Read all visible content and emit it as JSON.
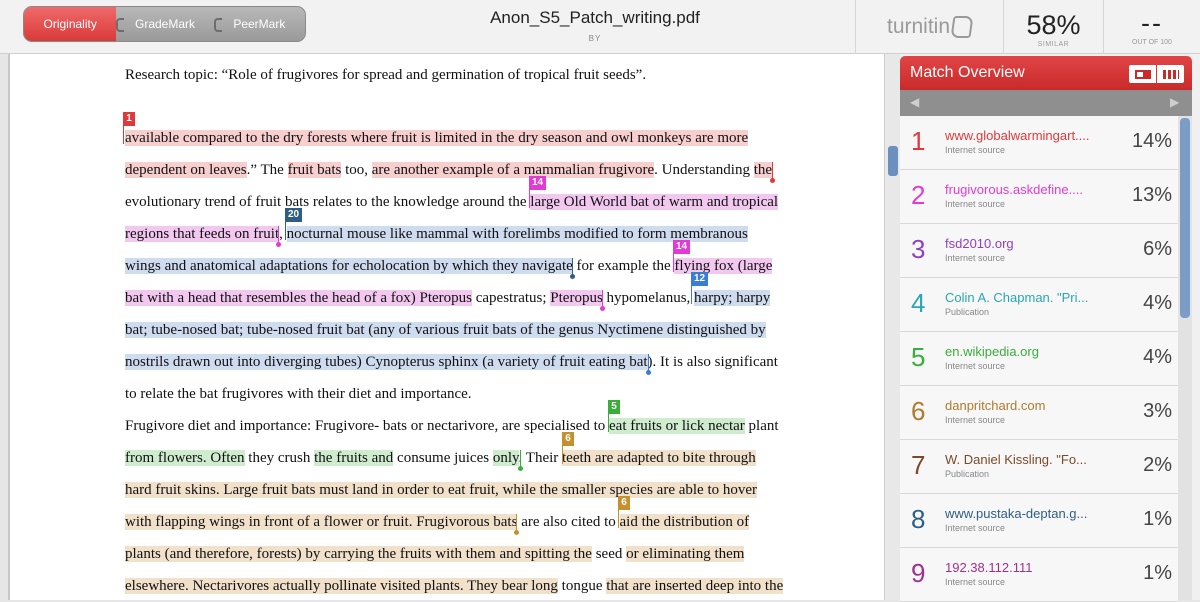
{
  "modes": [
    "Originality",
    "GradeMark",
    "PeerMark"
  ],
  "document": {
    "title": "Anon_S5_Patch_writing.pdf",
    "by": "BY"
  },
  "brand": "turnitin",
  "similarity": {
    "value": "58%",
    "label": "SIMILAR"
  },
  "grade": {
    "value": "--",
    "label": "OUT OF 100"
  },
  "panel": {
    "title": "Match Overview"
  },
  "colors": {
    "red": "#e0393b",
    "pink": "#e23ad6",
    "purple": "#8f3fbf",
    "teal": "#2aa7b5",
    "green": "#3aae3a",
    "brown": "#b07b2e",
    "darkbrown": "#7a4a2a",
    "navy": "#2e5e86",
    "magenta": "#a0308f"
  },
  "matches": [
    {
      "num": "1",
      "source": "www.globalwarmingart....",
      "type": "Internet source",
      "pct": "14%",
      "color": "#e0393b"
    },
    {
      "num": "2",
      "source": "frugivorous.askdefine....",
      "type": "Internet source",
      "pct": "13%",
      "color": "#e23ad6"
    },
    {
      "num": "3",
      "source": "fsd2010.org",
      "type": "Internet source",
      "pct": "6%",
      "color": "#8f3fbf"
    },
    {
      "num": "4",
      "source": "Colin A. Chapman. \"Pri...",
      "type": "Publication",
      "pct": "4%",
      "color": "#2aa7b5"
    },
    {
      "num": "5",
      "source": "en.wikipedia.org",
      "type": "Internet source",
      "pct": "4%",
      "color": "#3aae3a"
    },
    {
      "num": "6",
      "source": "danpritchard.com",
      "type": "Internet source",
      "pct": "3%",
      "color": "#b07b2e"
    },
    {
      "num": "7",
      "source": "W. Daniel Kissling. \"Fo...",
      "type": "Publication",
      "pct": "2%",
      "color": "#7a4a2a"
    },
    {
      "num": "8",
      "source": "www.pustaka-deptan.g...",
      "type": "Internet source",
      "pct": "1%",
      "color": "#2e5e86"
    },
    {
      "num": "9",
      "source": "192.38.112.111",
      "type": "Internet source",
      "pct": "1%",
      "color": "#a0308f"
    }
  ],
  "lines": [
    {
      "segments": [
        {
          "t": "Research topic: “Role of frugivores for spread and germination of tropical fruit seeds”.",
          "h": ""
        }
      ]
    },
    {
      "segments": [
        {
          "t": "available compared to the dry forests where fruit is limited in the dry season and owl monkeys are more",
          "h": "red"
        }
      ]
    },
    {
      "segments": [
        {
          "t": "dependent on leaves",
          "h": "red"
        },
        {
          "t": ".” The ",
          "h": ""
        },
        {
          "t": "fruit bats",
          "h": "red"
        },
        {
          "t": " too, ",
          "h": ""
        },
        {
          "t": "are another example of a mammalian frugivore",
          "h": "red"
        },
        {
          "t": ". Understanding ",
          "h": ""
        },
        {
          "t": "the",
          "h": "red"
        }
      ]
    },
    {
      "segments": [
        {
          "t": "evolutionary trend of fruit bats relates to the knowledge around the ",
          "h": ""
        },
        {
          "t": "large Old World bat of warm and tropical",
          "h": "pink"
        }
      ]
    },
    {
      "segments": [
        {
          "t": "regions that feeds on fruit",
          "h": "pink"
        },
        {
          "t": ", ",
          "h": ""
        },
        {
          "t": "nocturnal mouse like mammal with forelimbs modified to form membranous",
          "h": "blue"
        }
      ]
    },
    {
      "segments": [
        {
          "t": "wings and anatomical adaptations for echolocation by which they navigate",
          "h": "blue"
        },
        {
          "t": " for example the ",
          "h": ""
        },
        {
          "t": "flying fox (large",
          "h": "pink"
        }
      ]
    },
    {
      "segments": [
        {
          "t": "bat with a head that resembles the head of a fox) Pteropus",
          "h": "pink"
        },
        {
          "t": " capestratus; ",
          "h": ""
        },
        {
          "t": "Pteropus",
          "h": "pink"
        },
        {
          "t": " hypomelanus, ",
          "h": ""
        },
        {
          "t": "harpy; harpy",
          "h": "blue"
        }
      ]
    },
    {
      "segments": [
        {
          "t": "bat; tube-nosed bat; tube-nosed fruit bat (any of various fruit bats of the genus Nyctimene distinguished by",
          "h": "blue"
        }
      ]
    },
    {
      "segments": [
        {
          "t": "nostrils drawn out into diverging tubes) Cynopterus sphinx (a variety of fruit eating bat",
          "h": "blue"
        },
        {
          "t": "). It is also significant",
          "h": ""
        }
      ]
    },
    {
      "segments": [
        {
          "t": "to relate the bat frugivores with their diet and importance.",
          "h": ""
        }
      ]
    },
    {
      "segments": [
        {
          "t": "Frugivore diet and importance: Frugivore- bats or nectarivore, are specialised to ",
          "h": ""
        },
        {
          "t": "eat fruits or lick nectar",
          "h": "green"
        },
        {
          "t": " plant",
          "h": ""
        }
      ]
    },
    {
      "segments": [
        {
          "t": "from flowers. Often",
          "h": "green"
        },
        {
          "t": " they crush ",
          "h": ""
        },
        {
          "t": "the fruits and",
          "h": "green"
        },
        {
          "t": " consume juices ",
          "h": ""
        },
        {
          "t": "only",
          "h": "green"
        },
        {
          "t": ". Their ",
          "h": ""
        },
        {
          "t": "teeth are adapted to bite through",
          "h": "tan"
        }
      ]
    },
    {
      "segments": [
        {
          "t": "hard fruit skins. Large fruit bats must land in order to eat fruit, while the smaller species are able to hover",
          "h": "tan"
        }
      ]
    },
    {
      "segments": [
        {
          "t": "with flapping wings in front of a flower or fruit. Frugivorous bats",
          "h": "tan"
        },
        {
          "t": " are also cited to ",
          "h": ""
        },
        {
          "t": "aid the distribution of",
          "h": "tan"
        }
      ]
    },
    {
      "segments": [
        {
          "t": "plants (and therefore, forests) by carrying the fruits with them and spitting the",
          "h": "tan"
        },
        {
          "t": " seed ",
          "h": ""
        },
        {
          "t": "or eliminating them",
          "h": "tan"
        }
      ]
    },
    {
      "segments": [
        {
          "t": "elsewhere. Nectarivores actually pollinate visited plants. They bear long",
          "h": "tan"
        },
        {
          "t": " tongue ",
          "h": ""
        },
        {
          "t": "that are inserted deep into the",
          "h": "tan"
        }
      ]
    }
  ],
  "markers": [
    "1",
    "14",
    "20",
    "14",
    "12",
    "5",
    "6",
    "6"
  ]
}
